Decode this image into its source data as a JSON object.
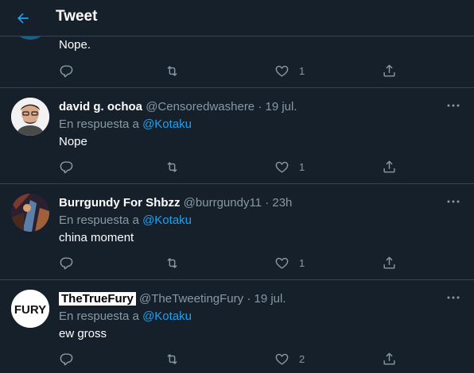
{
  "header": {
    "title": "Tweet"
  },
  "tweets": [
    {
      "text": "Nope.",
      "likes": "1"
    },
    {
      "display_name": "david g. ochoa",
      "handle": "@Censoredwashere",
      "dot": "·",
      "time": "19 jul.",
      "reply_prefix": "En respuesta a",
      "reply_to": "@Kotaku",
      "text": "Nope",
      "likes": "1"
    },
    {
      "display_name": "Burrgundy For Shbzz",
      "handle": "@burrgundy11",
      "dot": "·",
      "time": "23h",
      "reply_prefix": "En respuesta a",
      "reply_to": "@Kotaku",
      "text": "china moment",
      "likes": "1"
    },
    {
      "display_name": "TheTrueFury",
      "handle": "@TheTweetingFury",
      "dot": "·",
      "time": "19 jul.",
      "reply_prefix": "En respuesta a",
      "reply_to": "@Kotaku",
      "text": "ew gross",
      "likes": "2",
      "avatar_text": "FURY"
    }
  ],
  "colors": {
    "background": "#15202b",
    "border": "#38444d",
    "secondary_text": "#8899a6",
    "accent": "#1da1f2"
  }
}
